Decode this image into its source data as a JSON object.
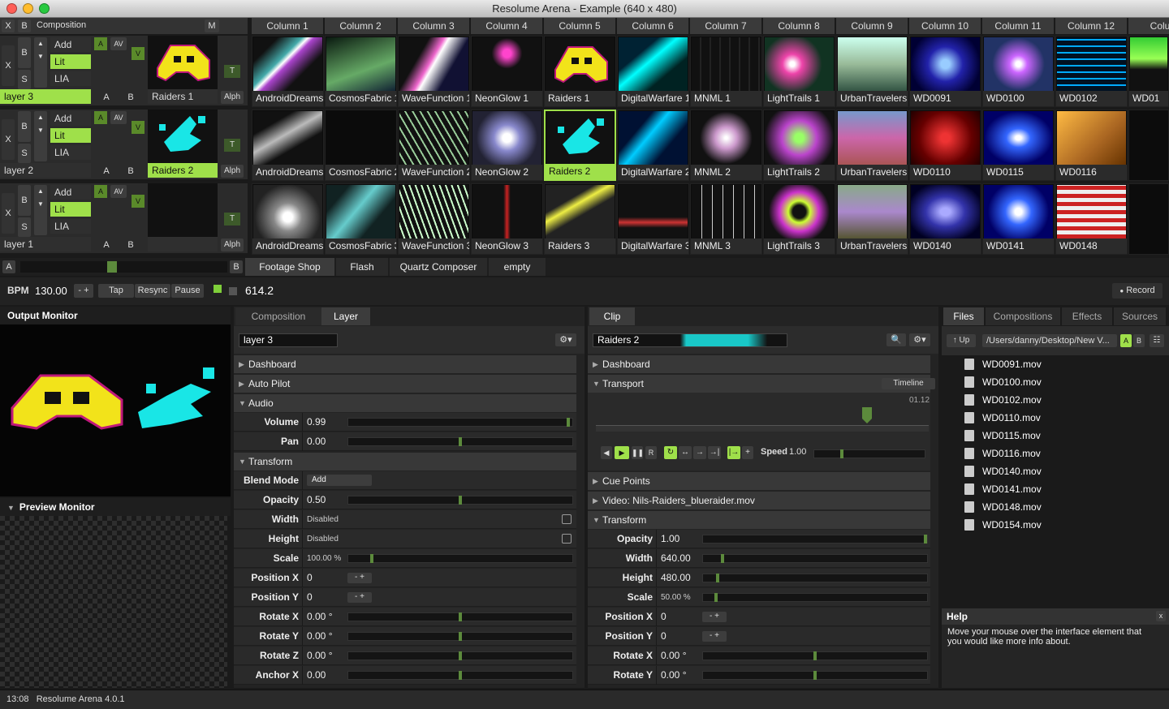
{
  "window": {
    "title": "Resolume Arena - Example (640 x 480)"
  },
  "composition": {
    "x": "X",
    "b": "B",
    "label": "Composition",
    "m": "M"
  },
  "layers": [
    {
      "name": "layer 3",
      "blend": "Add",
      "lit": "Lit",
      "lia": "LIA",
      "clip": "Raiders 1",
      "x": "X",
      "b": "B",
      "s": "S",
      "av": "AV",
      "v": "V",
      "t": "T",
      "alph": "Alph",
      "a_btn": "A",
      "b_btn": "B"
    },
    {
      "name": "layer 2",
      "blend": "Add",
      "lit": "Lit",
      "lia": "LIA",
      "clip": "Raiders 2",
      "x": "X",
      "b": "B",
      "s": "S",
      "av": "AV",
      "v": "V",
      "t": "T",
      "alph": "Alph",
      "a_btn": "A",
      "b_btn": "B"
    },
    {
      "name": "layer 1",
      "blend": "Add",
      "lit": "Lit",
      "lia": "LIA",
      "clip": "",
      "x": "X",
      "b": "B",
      "s": "S",
      "av": "AV",
      "v": "V",
      "t": "T",
      "alph": "Alph",
      "a_btn": "A",
      "b_btn": "B"
    }
  ],
  "columns": [
    "Column 1",
    "Column 2",
    "Column 3",
    "Column 4",
    "Column 5",
    "Column 6",
    "Column 7",
    "Column 8",
    "Column 9",
    "Column 10",
    "Column 11",
    "Column 12",
    "Colum"
  ],
  "clips": [
    [
      "AndroidDreams 1",
      "CosmosFabric 1",
      "WaveFunction 1",
      "NeonGlow 1",
      "Raiders 1",
      "DigitalWarfare 1",
      "MNML 1",
      "LightTrails 1",
      "UrbanTravelers 1",
      "WD0091",
      "WD0100",
      "WD0102",
      "WD01"
    ],
    [
      "AndroidDreams 2",
      "CosmosFabric 2",
      "WaveFunction 2",
      "NeonGlow 2",
      "Raiders 2",
      "DigitalWarfare 2",
      "MNML 2",
      "LightTrails 2",
      "UrbanTravelers 2",
      "WD0110",
      "WD0115",
      "WD0116",
      ""
    ],
    [
      "AndroidDreams 3",
      "CosmosFabric 3",
      "WaveFunction 3",
      "NeonGlow 3",
      "Raiders 3",
      "DigitalWarfare 3",
      "MNML 3",
      "LightTrails 3",
      "UrbanTravelers 3",
      "WD0140",
      "WD0141",
      "WD0148",
      ""
    ]
  ],
  "crossfader": {
    "a": "A",
    "b": "B",
    "position": 0.44
  },
  "deck_tabs": [
    "Footage Shop",
    "Flash",
    "Quartz Composer",
    "empty"
  ],
  "bpm": {
    "label": "BPM",
    "value": "130.00",
    "minus": "-",
    "plus": "+",
    "tap": "Tap",
    "resync": "Resync",
    "pause": "Pause",
    "beat": "614.2",
    "record": "Record"
  },
  "monitors": {
    "output": "Output Monitor",
    "preview": "Preview Monitor"
  },
  "layer_panel": {
    "tabs": [
      "Composition",
      "Layer"
    ],
    "name": "layer 3",
    "dashboard": "Dashboard",
    "autopilot": "Auto Pilot",
    "audio": "Audio",
    "transform": "Transform",
    "rows": [
      {
        "label": "Volume",
        "value": "0.99",
        "level": 0.99
      },
      {
        "label": "Pan",
        "value": "0.00",
        "level": 0.5
      },
      {
        "label": "Blend Mode",
        "value": "Add"
      },
      {
        "label": "Opacity",
        "value": "0.50",
        "level": 0.5
      },
      {
        "label": "Width",
        "value": "Disabled"
      },
      {
        "label": "Height",
        "value": "Disabled"
      },
      {
        "label": "Scale",
        "value": "100.00 %",
        "level": 0.1
      },
      {
        "label": "Position X",
        "value": "0",
        "stepper": "-  +"
      },
      {
        "label": "Position Y",
        "value": "0",
        "stepper": "-  +"
      },
      {
        "label": "Rotate X",
        "value": "0.00 °",
        "level": 0.5
      },
      {
        "label": "Rotate Y",
        "value": "0.00 °",
        "level": 0.5
      },
      {
        "label": "Rotate Z",
        "value": "0.00 °",
        "level": 0.5
      },
      {
        "label": "Anchor X",
        "value": "0.00",
        "level": 0.5
      }
    ]
  },
  "clip_panel": {
    "tab": "Clip",
    "name": "Raiders 2",
    "dashboard": "Dashboard",
    "transport": "Transport",
    "timeline": "Timeline",
    "time": "01.12",
    "speed_label": "Speed",
    "speed": "1.00",
    "cue": "Cue Points",
    "video": "Video: Nils-Raiders_blueraider.mov",
    "transform": "Transform",
    "rows": [
      {
        "label": "Opacity",
        "value": "1.00",
        "level": 1.0
      },
      {
        "label": "Width",
        "value": "640.00",
        "level": 0.08
      },
      {
        "label": "Height",
        "value": "480.00",
        "level": 0.06
      },
      {
        "label": "Scale",
        "value": "50.00 %",
        "level": 0.05
      },
      {
        "label": "Position X",
        "value": "0",
        "stepper": "-  +"
      },
      {
        "label": "Position Y",
        "value": "0",
        "stepper": "-  +"
      },
      {
        "label": "Rotate X",
        "value": "0.00 °",
        "level": 0.5
      },
      {
        "label": "Rotate Y",
        "value": "0.00 °",
        "level": 0.5
      }
    ]
  },
  "browser": {
    "tabs": [
      "Files",
      "Compositions",
      "Effects",
      "Sources"
    ],
    "up": "Up",
    "path": "/Users/danny/Desktop/New V...",
    "a": "A",
    "b": "B",
    "files": [
      "WD0091.mov",
      "WD0100.mov",
      "WD0102.mov",
      "WD0110.mov",
      "WD0115.mov",
      "WD0116.mov",
      "WD0140.mov",
      "WD0141.mov",
      "WD0148.mov",
      "WD0154.mov"
    ]
  },
  "help": {
    "title": "Help",
    "text": "Move your mouse over the interface element that you would like more info about.",
    "close": "x"
  },
  "status": {
    "time": "13:08",
    "app": "Resolume Arena 4.0.1"
  },
  "colors": {
    "accent": "#9fe04a",
    "cyan": "#19e6e6",
    "yellow": "#f2e31a"
  }
}
